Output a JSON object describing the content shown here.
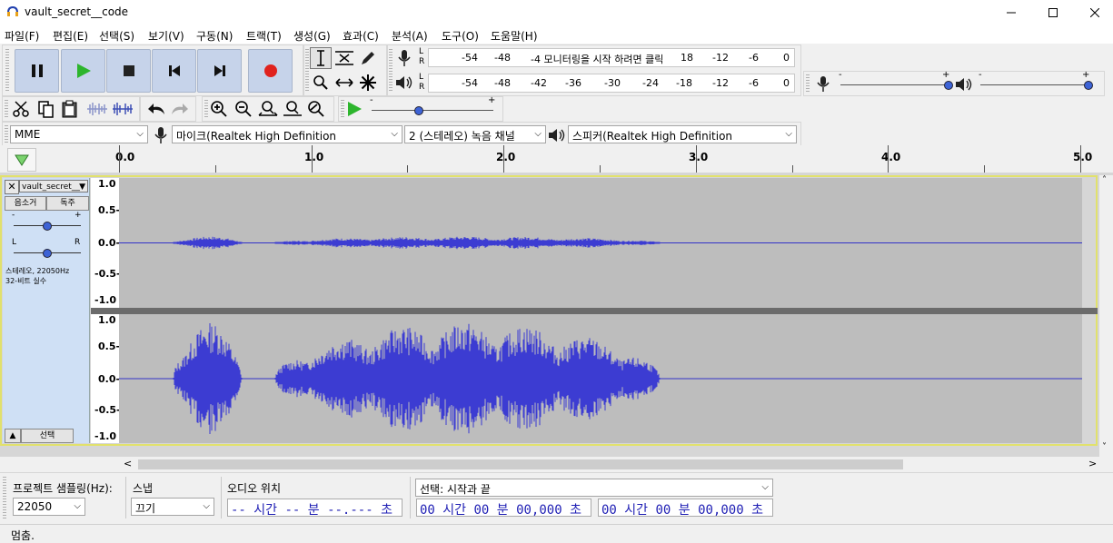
{
  "window": {
    "title": "vault_secret__code"
  },
  "menu": [
    "파일(F)",
    "편집(E)",
    "선택(S)",
    "보기(V)",
    "구동(N)",
    "트랙(T)",
    "생성(G)",
    "효과(C)",
    "분석(A)",
    "도구(O)",
    "도움말(H)"
  ],
  "meters": {
    "record_ticks": [
      "-54",
      "-48",
      "-4 모니터링을 시작 하려면 클릭",
      "18",
      "-12",
      "-6",
      "0"
    ],
    "playback_ticks": [
      "-54",
      "-48",
      "-42",
      "-36",
      "-30",
      "-24",
      "-18",
      "-12",
      "-6",
      "0"
    ],
    "lr": [
      "L",
      "R"
    ]
  },
  "mixer": {
    "rec_min": "-",
    "rec_max": "+",
    "play_min": "-",
    "play_max": "+",
    "rec_level": 1.0,
    "play_level": 1.0
  },
  "play_at_speed": {
    "min": "-",
    "max": "+",
    "value": 0.38
  },
  "devices": {
    "host": "MME",
    "mic": "마이크(Realtek High Definition",
    "channels": "2 (스테레오) 녹음 채널",
    "speaker": "스피커(Realtek High Definition"
  },
  "ruler": {
    "labels": [
      "0.0",
      "1.0",
      "2.0",
      "3.0",
      "4.0",
      "5.0"
    ]
  },
  "track": {
    "name": "vault_secret__",
    "mute": "음소거",
    "solo": "독주",
    "gain_min": "-",
    "gain_max": "+",
    "pan_left": "L",
    "pan_right": "R",
    "info_line1": "스테레오, 22050Hz",
    "info_line2": "32-비트 실수",
    "select": "선택",
    "scale": [
      "1.0",
      "0.5-",
      "0.0-",
      "-0.5-",
      "-1.0"
    ]
  },
  "bottom": {
    "rate_label": "프로젝트 샘플링(Hz):",
    "rate_value": "22050",
    "snap_label": "스냅",
    "snap_value": "끄기",
    "audio_pos_label": "오디오 위치",
    "audio_pos_value": "-- 시간 -- 분 --.--- 초",
    "selection_label": "선택: 시작과 끝",
    "sel_start": "00 시간 00 분 00,000 초",
    "sel_end": "00 시간 00 분 00,000 초"
  },
  "status": "멈춤."
}
